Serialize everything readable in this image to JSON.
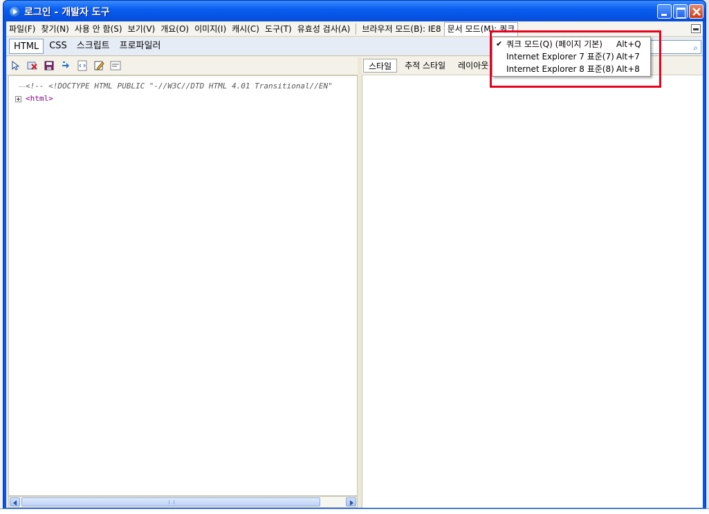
{
  "window": {
    "title": "로그인 - 개발자 도구"
  },
  "menubar": {
    "items": [
      "파일(F)",
      "찾기(N)",
      "사용 안 함(S)",
      "보기(V)",
      "개요(O)",
      "이미지(I)",
      "캐시(C)",
      "도구(T)",
      "유효성 검사(A)"
    ],
    "browser_mode": "브라우저 모드(B): IE8",
    "document_mode": "문서 모드(M): 쿼크"
  },
  "tabs": {
    "items": [
      "HTML",
      "CSS",
      "스크립트",
      "프로파일러"
    ],
    "active": "HTML"
  },
  "toolbar_icons": [
    "select-element-icon",
    "clear-icon",
    "save-icon",
    "refresh-icon",
    "view-source-icon",
    "edit-icon",
    "word-wrap-icon"
  ],
  "tree": {
    "doctype": "<!-- <!DOCTYPE HTML PUBLIC \"-//W3C//DTD HTML 4.01 Transitional//EN\"",
    "root": "<html>"
  },
  "right_tabs": {
    "items": [
      "스타일",
      "추적 스타일",
      "레이아웃"
    ],
    "active": "스타일"
  },
  "document_mode_menu": {
    "items": [
      {
        "label": "쿼크 모드(Q) (페이지 기본)",
        "shortcut": "Alt+Q",
        "checked": true
      },
      {
        "label": "Internet Explorer 7 표준(7)",
        "shortcut": "Alt+7",
        "checked": false
      },
      {
        "label": "Internet Explorer 8 표준(8)",
        "shortcut": "Alt+8",
        "checked": false
      }
    ]
  },
  "colors": {
    "title_bar": "#0a5ff0",
    "highlight_box": "#e8001c",
    "tag_color": "#800080"
  }
}
